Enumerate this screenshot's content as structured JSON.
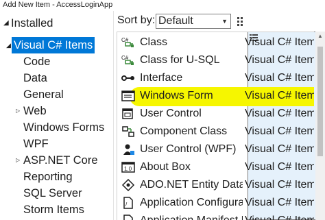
{
  "window": {
    "title": "Add New Item - AccessLoginApp"
  },
  "tree": {
    "installed": "Installed",
    "selected": "Visual C# Items",
    "children": [
      {
        "label": "Code",
        "expandable": false
      },
      {
        "label": "Data",
        "expandable": false
      },
      {
        "label": "General",
        "expandable": false
      },
      {
        "label": "Web",
        "expandable": true
      },
      {
        "label": "Windows Forms",
        "expandable": false
      },
      {
        "label": "WPF",
        "expandable": false
      },
      {
        "label": "ASP.NET Core",
        "expandable": true
      },
      {
        "label": "Reporting",
        "expandable": false
      },
      {
        "label": "SQL Server",
        "expandable": false
      },
      {
        "label": "Storm Items",
        "expandable": false
      }
    ]
  },
  "sort": {
    "label": "Sort by:",
    "value": "Default"
  },
  "templates": [
    {
      "name": "Class",
      "type": "Visual C# Item",
      "icon": "class-icon"
    },
    {
      "name": "Class for U-SQL",
      "type": "Visual C# Item",
      "icon": "class-usql-icon"
    },
    {
      "name": "Interface",
      "type": "Visual C# Item",
      "icon": "interface-icon"
    },
    {
      "name": "Windows Form",
      "type": "Visual C# Item",
      "icon": "windows-form-icon"
    },
    {
      "name": "User Control",
      "type": "Visual C# Item",
      "icon": "user-control-icon"
    },
    {
      "name": "Component Class",
      "type": "Visual C# Item",
      "icon": "component-class-icon"
    },
    {
      "name": "User Control (WPF)",
      "type": "Visual C# Item",
      "icon": "user-control-wpf-icon"
    },
    {
      "name": "About Box",
      "type": "Visual C# Item",
      "icon": "about-box-icon"
    },
    {
      "name": "ADO.NET Entity Data Model",
      "type": "Visual C# Item",
      "icon": "ado-net-icon"
    },
    {
      "name": "Application Configuration File",
      "type": "Visual C# Item",
      "icon": "app-config-icon"
    },
    {
      "name": "Application Manifest File",
      "type": "Visual C# Item",
      "icon": "app-manifest-icon"
    }
  ],
  "highlight_color": "#f6f600",
  "accent_color": "#0078d7"
}
